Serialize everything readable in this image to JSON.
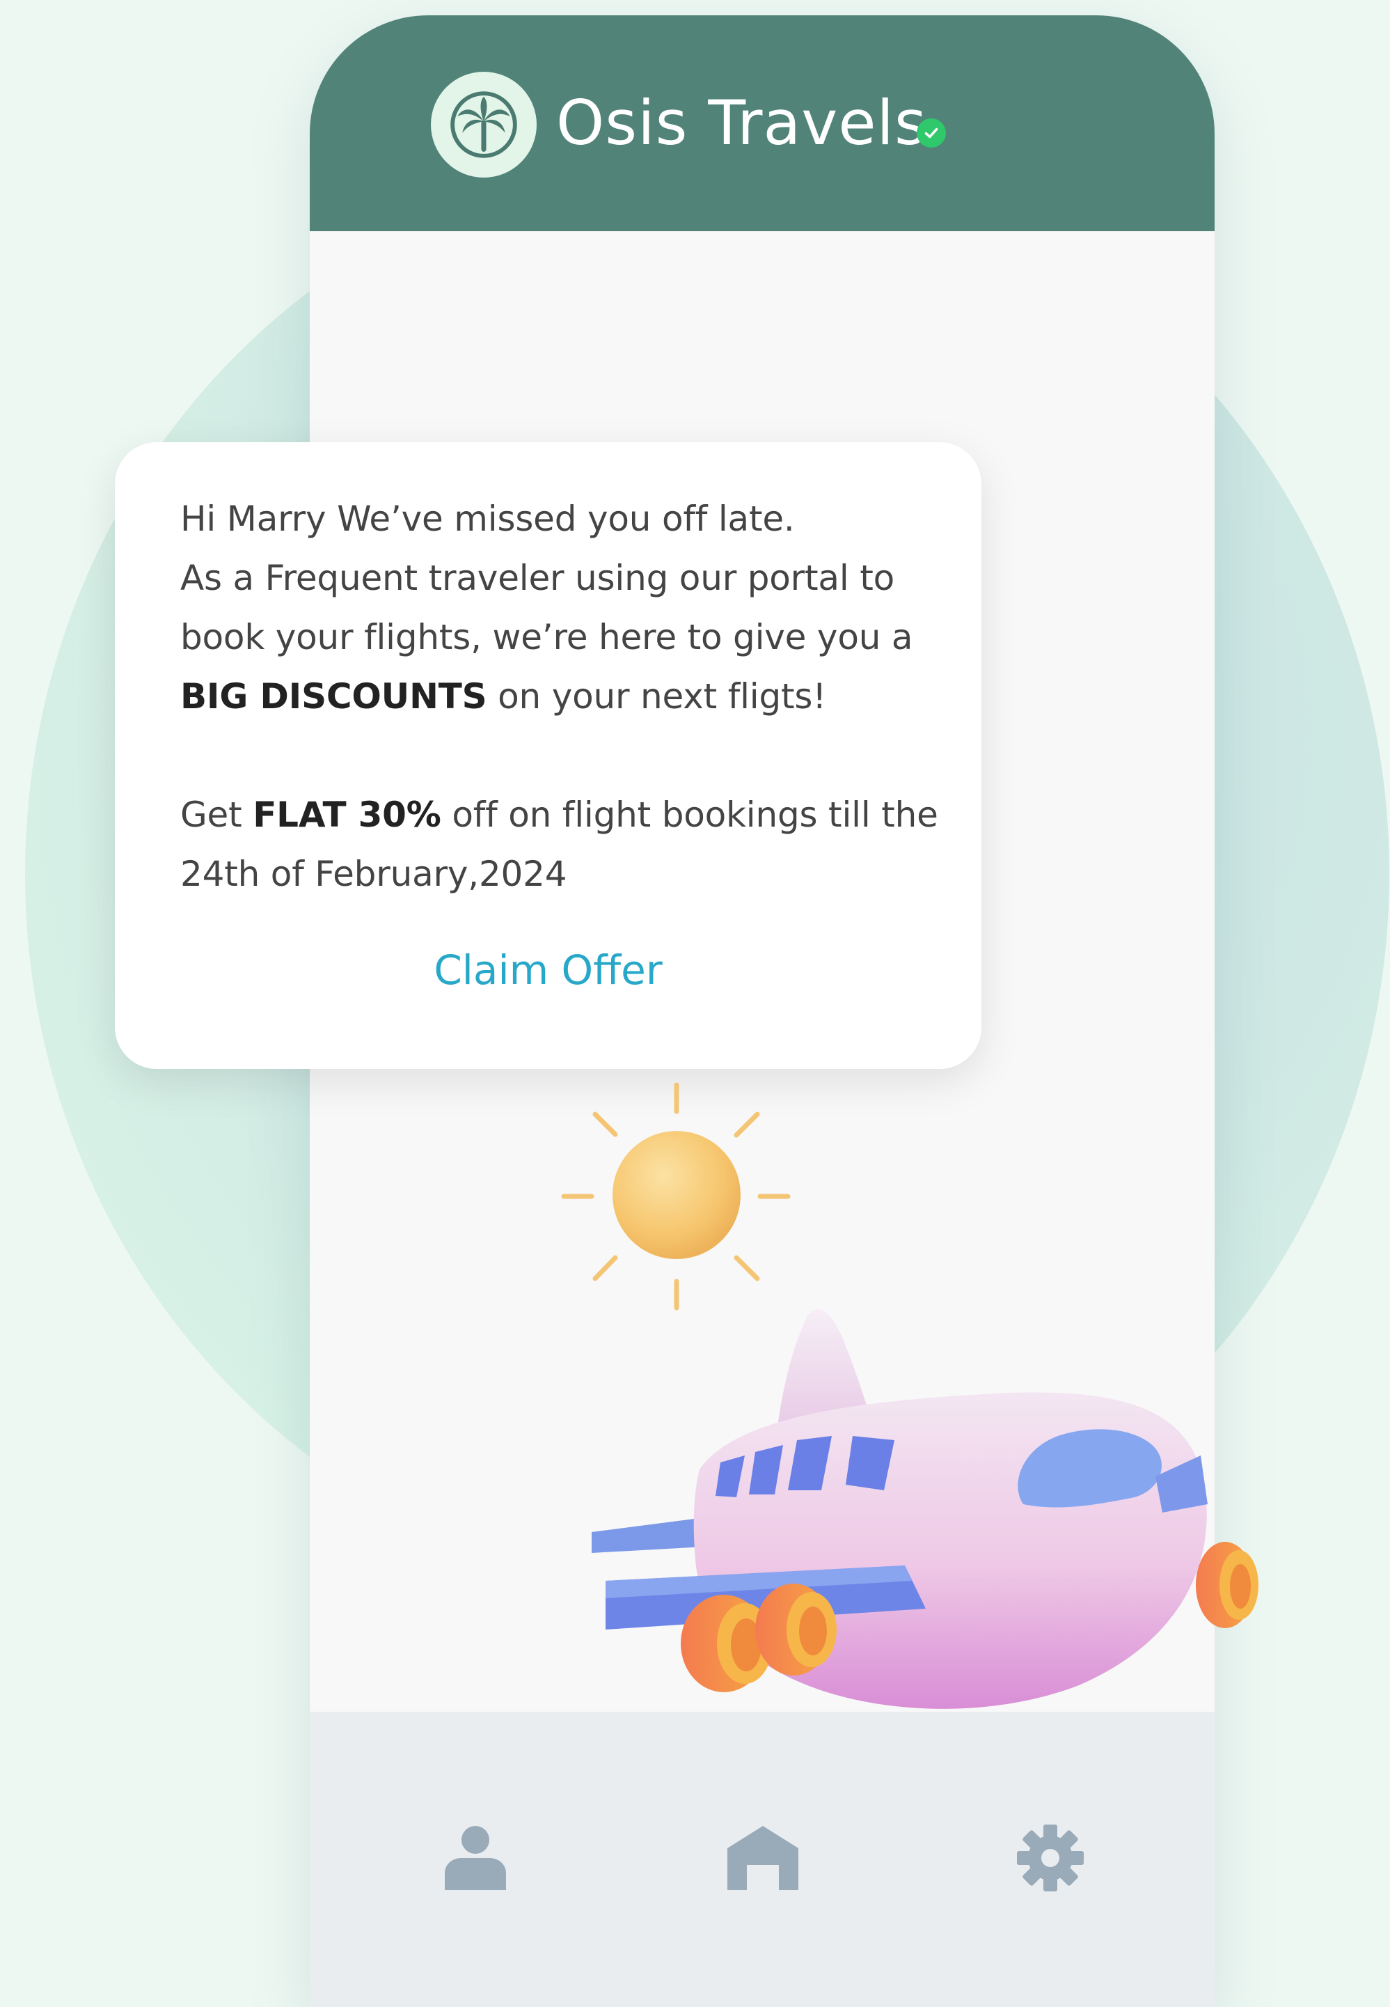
{
  "app": {
    "title": "Osis Travels"
  },
  "card": {
    "line1": "Hi Marry We’ve missed you off late.",
    "line2": "As a Frequent traveler using our portal to",
    "line3": "book your flights, we’re here to give you a",
    "line4_bold": "BIG DISCOUNTS",
    "line4_rest": " on your next fligts!",
    "line5_pre": "Get ",
    "line5_bold": "FLAT 30%",
    "line5_rest": " off on flight bookings till the",
    "line6": "24th of February,2024",
    "cta": "Claim Offer"
  },
  "nav": {
    "items": [
      {
        "icon": "user-icon"
      },
      {
        "icon": "home-icon"
      },
      {
        "icon": "gear-icon"
      }
    ]
  },
  "colors": {
    "header": "#518379",
    "logo_bg": "#e2f5e8",
    "verified": "#2fc86a",
    "cta": "#27a8c8",
    "nav_bg": "#eaedf0",
    "nav_icon": "#99aab8"
  },
  "illustrations": [
    "sun-icon",
    "airplane-illustration"
  ]
}
